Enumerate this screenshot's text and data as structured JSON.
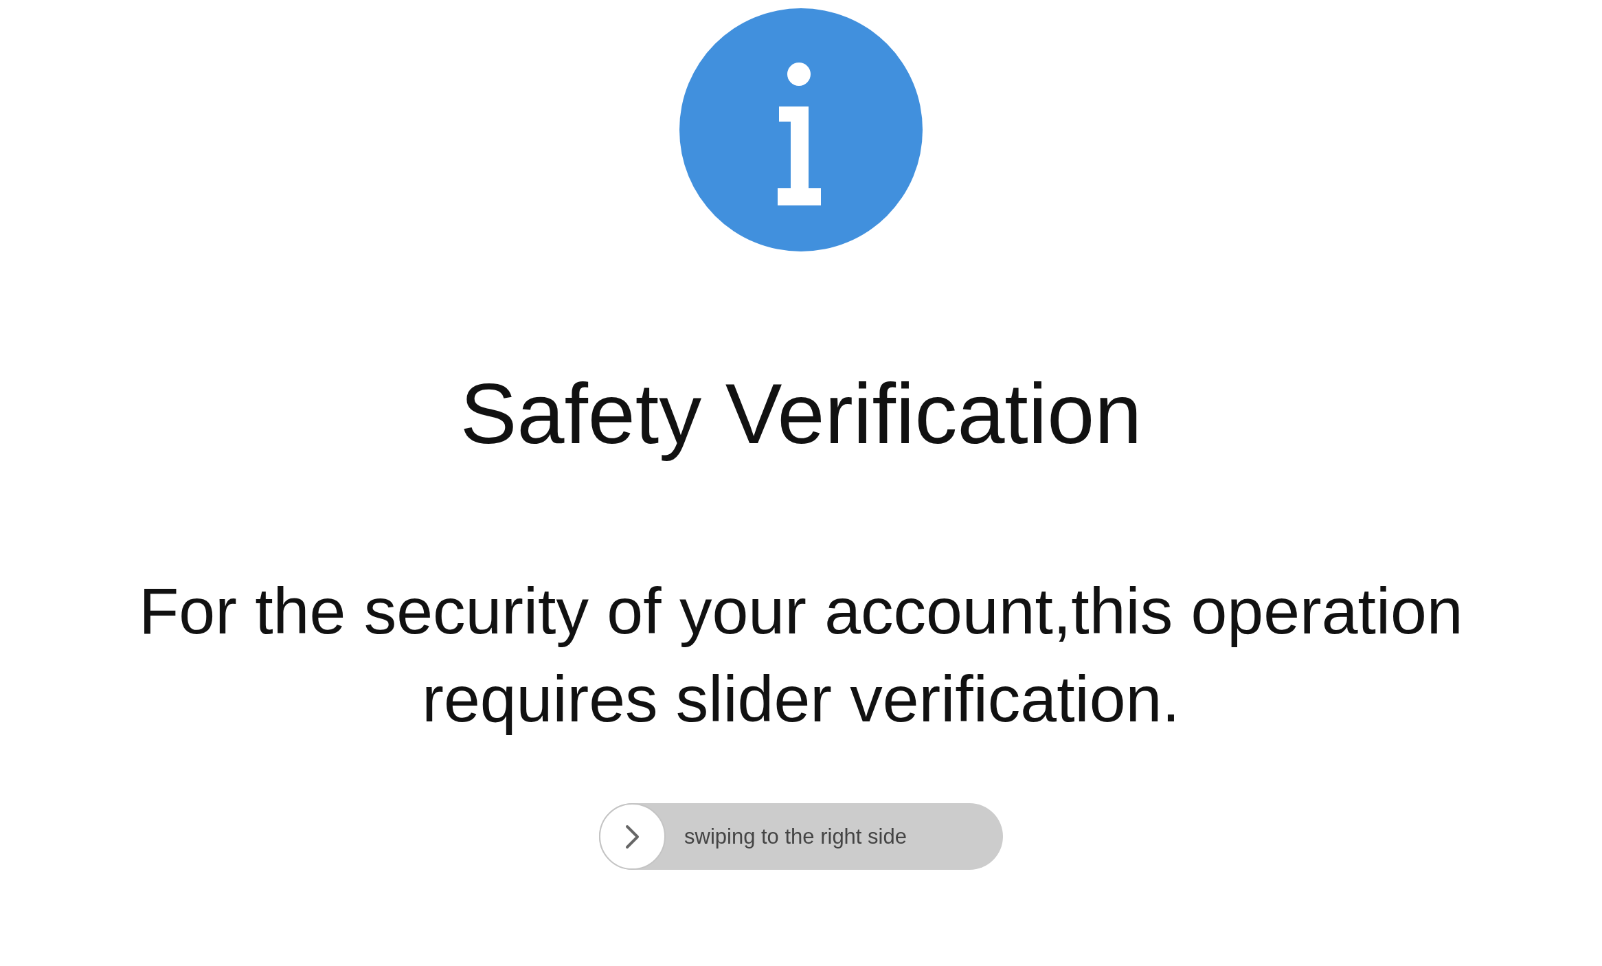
{
  "title": "Safety Verification",
  "message": "For the security of your account,this operation requires slider verification.",
  "slider": {
    "label": "swiping to the right side",
    "level": 0
  }
}
